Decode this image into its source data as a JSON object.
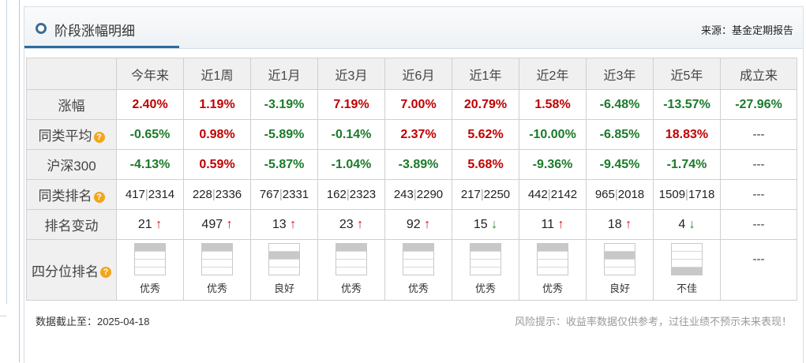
{
  "header": {
    "title": "阶段涨幅明细",
    "source": "来源：基金定期报告"
  },
  "columns": [
    "今年来",
    "近1周",
    "近1月",
    "近3月",
    "近6月",
    "近1年",
    "近2年",
    "近3年",
    "近5年",
    "成立来"
  ],
  "rows": {
    "return": {
      "label": "涨幅",
      "values": [
        {
          "text": "2.40%",
          "tone": "red"
        },
        {
          "text": "1.19%",
          "tone": "red"
        },
        {
          "text": "-3.19%",
          "tone": "green"
        },
        {
          "text": "7.19%",
          "tone": "red"
        },
        {
          "text": "7.00%",
          "tone": "red"
        },
        {
          "text": "20.79%",
          "tone": "red"
        },
        {
          "text": "1.58%",
          "tone": "red"
        },
        {
          "text": "-6.48%",
          "tone": "green"
        },
        {
          "text": "-13.57%",
          "tone": "green"
        },
        {
          "text": "-27.96%",
          "tone": "green"
        }
      ]
    },
    "peer_avg": {
      "label": "同类平均",
      "help": "?",
      "values": [
        {
          "text": "-0.65%",
          "tone": "green"
        },
        {
          "text": "0.98%",
          "tone": "red"
        },
        {
          "text": "-5.89%",
          "tone": "green"
        },
        {
          "text": "-0.14%",
          "tone": "green"
        },
        {
          "text": "2.37%",
          "tone": "red"
        },
        {
          "text": "5.62%",
          "tone": "red"
        },
        {
          "text": "-10.00%",
          "tone": "green"
        },
        {
          "text": "-6.85%",
          "tone": "green"
        },
        {
          "text": "18.83%",
          "tone": "red"
        },
        {
          "text": "---",
          "tone": "dash"
        }
      ]
    },
    "csi300": {
      "label": "沪深300",
      "values": [
        {
          "text": "-4.13%",
          "tone": "green"
        },
        {
          "text": "0.59%",
          "tone": "red"
        },
        {
          "text": "-5.87%",
          "tone": "green"
        },
        {
          "text": "-1.04%",
          "tone": "green"
        },
        {
          "text": "-3.89%",
          "tone": "green"
        },
        {
          "text": "5.68%",
          "tone": "red"
        },
        {
          "text": "-9.36%",
          "tone": "green"
        },
        {
          "text": "-9.45%",
          "tone": "green"
        },
        {
          "text": "-1.74%",
          "tone": "green"
        },
        {
          "text": "---",
          "tone": "dash"
        }
      ]
    },
    "peer_rank": {
      "label": "同类排名",
      "help": "?",
      "values": [
        {
          "rank": "417",
          "total": "2314"
        },
        {
          "rank": "228",
          "total": "2336"
        },
        {
          "rank": "767",
          "total": "2331"
        },
        {
          "rank": "162",
          "total": "2323"
        },
        {
          "rank": "243",
          "total": "2290"
        },
        {
          "rank": "217",
          "total": "2250"
        },
        {
          "rank": "442",
          "total": "2142"
        },
        {
          "rank": "965",
          "total": "2018"
        },
        {
          "rank": "1509",
          "total": "1718"
        },
        {
          "dash": "---"
        }
      ]
    },
    "rank_change": {
      "label": "排名变动",
      "values": [
        {
          "text": "21",
          "arrow": "↑",
          "dir": "up"
        },
        {
          "text": "497",
          "arrow": "↑",
          "dir": "up"
        },
        {
          "text": "13",
          "arrow": "↑",
          "dir": "up"
        },
        {
          "text": "23",
          "arrow": "↑",
          "dir": "up"
        },
        {
          "text": "92",
          "arrow": "↑",
          "dir": "up"
        },
        {
          "text": "15",
          "arrow": "↓",
          "dir": "down"
        },
        {
          "text": "11",
          "arrow": "↑",
          "dir": "up"
        },
        {
          "text": "18",
          "arrow": "↑",
          "dir": "up"
        },
        {
          "text": "4",
          "arrow": "↓",
          "dir": "down"
        },
        {
          "dash": "---"
        }
      ]
    },
    "quartile": {
      "label": "四分位排名",
      "help": "?",
      "values": [
        {
          "quartile": 1,
          "label": "优秀"
        },
        {
          "quartile": 1,
          "label": "优秀"
        },
        {
          "quartile": 2,
          "label": "良好"
        },
        {
          "quartile": 1,
          "label": "优秀"
        },
        {
          "quartile": 1,
          "label": "优秀"
        },
        {
          "quartile": 1,
          "label": "优秀"
        },
        {
          "quartile": 1,
          "label": "优秀"
        },
        {
          "quartile": 2,
          "label": "良好"
        },
        {
          "quartile": 4,
          "label": "不佳"
        },
        {
          "dash": "---"
        }
      ]
    }
  },
  "colors": {
    "positive": "#c00000",
    "negative": "#1b7a2a",
    "header_accent": "#2d6aa0",
    "quartile_fill": "#c8c8c8"
  },
  "footer": {
    "date": "数据截止至：2025-04-18",
    "risk": "风险提示：收益率数据仅供参考，过往业绩不预示未来表现！"
  }
}
